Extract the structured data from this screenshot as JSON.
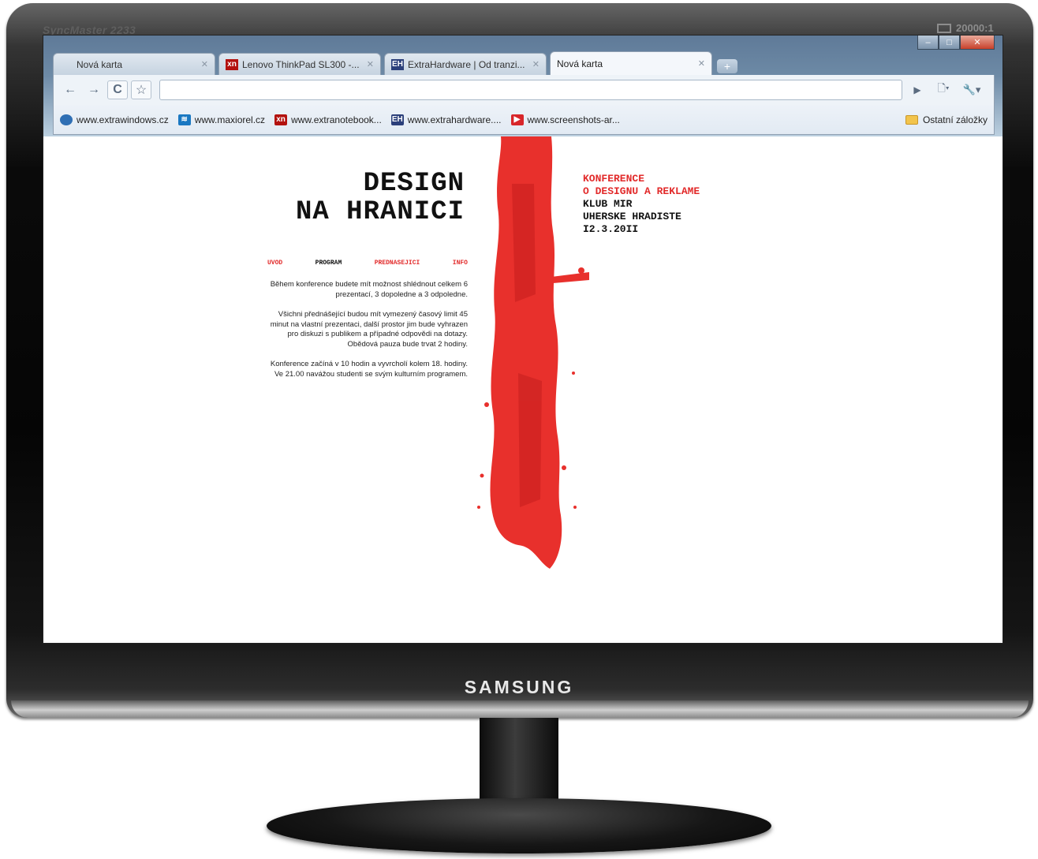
{
  "monitor": {
    "model": "SyncMaster 2233",
    "contrast": "20000:1",
    "brand": "SAMSUNG"
  },
  "browser": {
    "tabs": [
      {
        "label": "Nová karta",
        "favicon": "blank",
        "active": false
      },
      {
        "label": "Lenovo ThinkPad SL300 -...",
        "favicon": "xn-icon",
        "active": false
      },
      {
        "label": "ExtraHardware | Od tranzi...",
        "favicon": "eh-icon",
        "active": false
      },
      {
        "label": "Nová karta",
        "favicon": "blank",
        "active": true
      }
    ],
    "new_tab_symbol": "+",
    "window_controls": {
      "minimize": "–",
      "maximize": "□",
      "close": "✕"
    },
    "toolbar": {
      "back": "←",
      "forward": "→",
      "reload": "C",
      "star": "☆",
      "go": "▶",
      "page_menu": "🗋▾",
      "wrench_menu": "🔧▾",
      "omnibox_value": ""
    },
    "bookmarks": [
      {
        "label": "www.extrawindows.cz",
        "icon": "globe-icon",
        "color": "#2f6fb4"
      },
      {
        "label": "www.maxiorel.cz",
        "icon": "maxiorel-icon",
        "color": "#1a78c2"
      },
      {
        "label": "www.extranotebook...",
        "icon": "xn-icon",
        "color": "#b3120f"
      },
      {
        "label": "www.extrahardware....",
        "icon": "eh-icon",
        "color": "#2b3f7a"
      },
      {
        "label": "www.screenshots-ar...",
        "icon": "play-icon",
        "color": "#d8262a"
      }
    ],
    "other_bookmarks": "Ostatní záložky"
  },
  "page": {
    "title_line1": "DESIGN",
    "title_line2": "NA HRANICI",
    "info": {
      "line1": "KONFERENCE",
      "line2": "O DESIGNU A REKLAME",
      "line3": "KLUB MIR",
      "line4": "UHERSKE HRADISTE",
      "line5": "I2.3.20II"
    },
    "nav": {
      "uvod": "UVOD",
      "program": "PROGRAM",
      "prednasejici": "PREDNASEJICI",
      "info": "INFO"
    },
    "paragraphs": [
      "Během konference budete mít možnost shlédnout celkem 6 prezentací, 3 dopoledne a 3 odpoledne.",
      "Všichni přednášející budou mít vymezený časový limit 45 minut na vlastní prezentaci, další prostor jim bude vyhrazen pro diskuzi s publikem a případné odpovědi na dotazy. Obědová pauza bude trvat 2 hodiny.",
      "Konference začíná v 10 hodin a vyvrcholí kolem 18. hodiny. Ve 21.00 navážou studenti se svým kulturním programem."
    ],
    "accent_color": "#e22b2b"
  }
}
